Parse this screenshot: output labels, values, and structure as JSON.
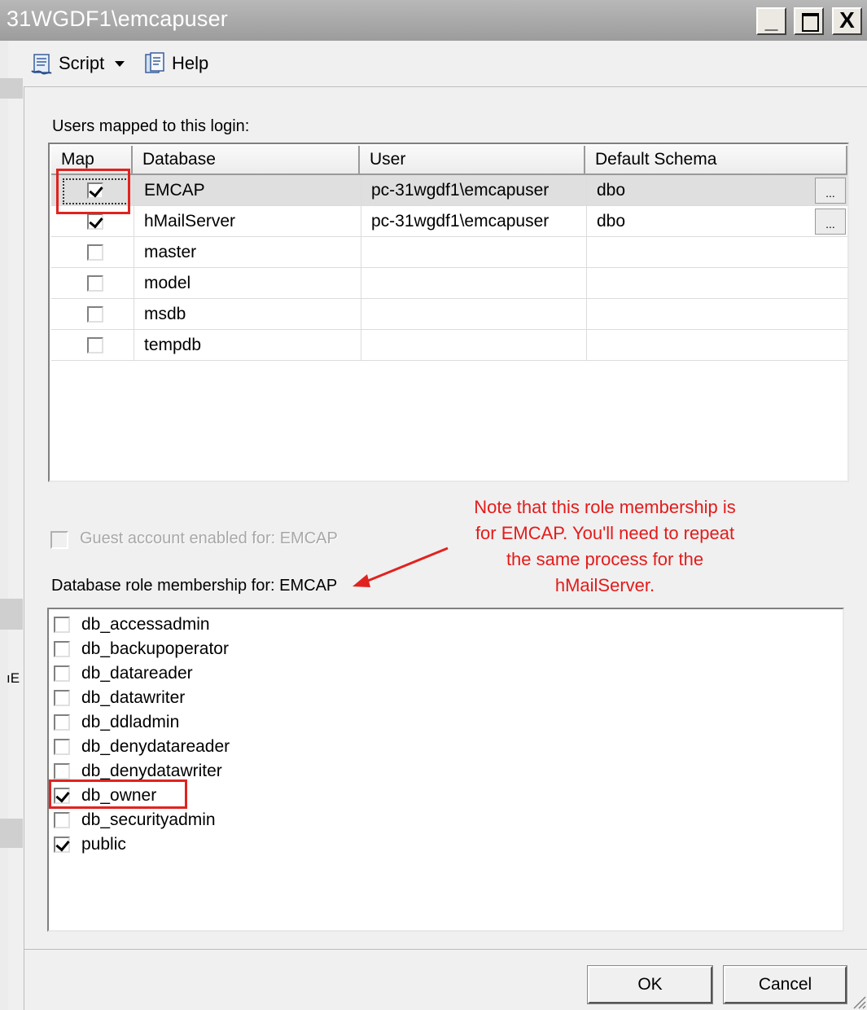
{
  "window": {
    "title": "31WGDF1\\emcapuser",
    "minimize_label": "_",
    "close_label": "X"
  },
  "toolbar": {
    "script_label": "Script",
    "help_label": "Help"
  },
  "users_mapped": {
    "label": "Users mapped to this login:",
    "columns": [
      "Map",
      "Database",
      "User",
      "Default Schema"
    ],
    "rows": [
      {
        "map": true,
        "database": "EMCAP",
        "user": "pc-31wgdf1\\emcapuser",
        "schema": "dbo",
        "has_ellipsis": true,
        "selected": true
      },
      {
        "map": true,
        "database": "hMailServer",
        "user": "pc-31wgdf1\\emcapuser",
        "schema": "dbo",
        "has_ellipsis": true,
        "selected": false
      },
      {
        "map": false,
        "database": "master",
        "user": "",
        "schema": "",
        "has_ellipsis": false,
        "selected": false
      },
      {
        "map": false,
        "database": "model",
        "user": "",
        "schema": "",
        "has_ellipsis": false,
        "selected": false
      },
      {
        "map": false,
        "database": "msdb",
        "user": "",
        "schema": "",
        "has_ellipsis": false,
        "selected": false
      },
      {
        "map": false,
        "database": "tempdb",
        "user": "",
        "schema": "",
        "has_ellipsis": false,
        "selected": false
      }
    ],
    "ellipsis_label": "..."
  },
  "guest": {
    "label": "Guest account enabled for: EMCAP",
    "checked": false,
    "enabled": false
  },
  "note": {
    "text_lines": [
      "Note that this role membership is",
      "for EMCAP. You'll need to repeat",
      "the same process for the",
      "hMailServer."
    ],
    "color": "#e31b1b"
  },
  "roles": {
    "label": "Database role membership for: EMCAP",
    "items": [
      {
        "name": "db_accessadmin",
        "checked": false
      },
      {
        "name": "db_backupoperator",
        "checked": false
      },
      {
        "name": "db_datareader",
        "checked": false
      },
      {
        "name": "db_datawriter",
        "checked": false
      },
      {
        "name": "db_ddladmin",
        "checked": false
      },
      {
        "name": "db_denydatareader",
        "checked": false
      },
      {
        "name": "db_denydatawriter",
        "checked": false
      },
      {
        "name": "db_owner",
        "checked": true
      },
      {
        "name": "db_securityadmin",
        "checked": false
      },
      {
        "name": "public",
        "checked": true
      }
    ]
  },
  "buttons": {
    "ok_label": "OK",
    "cancel_label": "Cancel"
  },
  "background_window": {
    "fragment_text": "ıE"
  },
  "icons": {
    "script": "script-icon",
    "dropdown": "dropdown-arrow-icon",
    "help": "help-icon",
    "checkmark": "checkmark-icon"
  },
  "colors": {
    "annotation_red": "#e0231f",
    "titlebar": "#a8a8a8"
  }
}
